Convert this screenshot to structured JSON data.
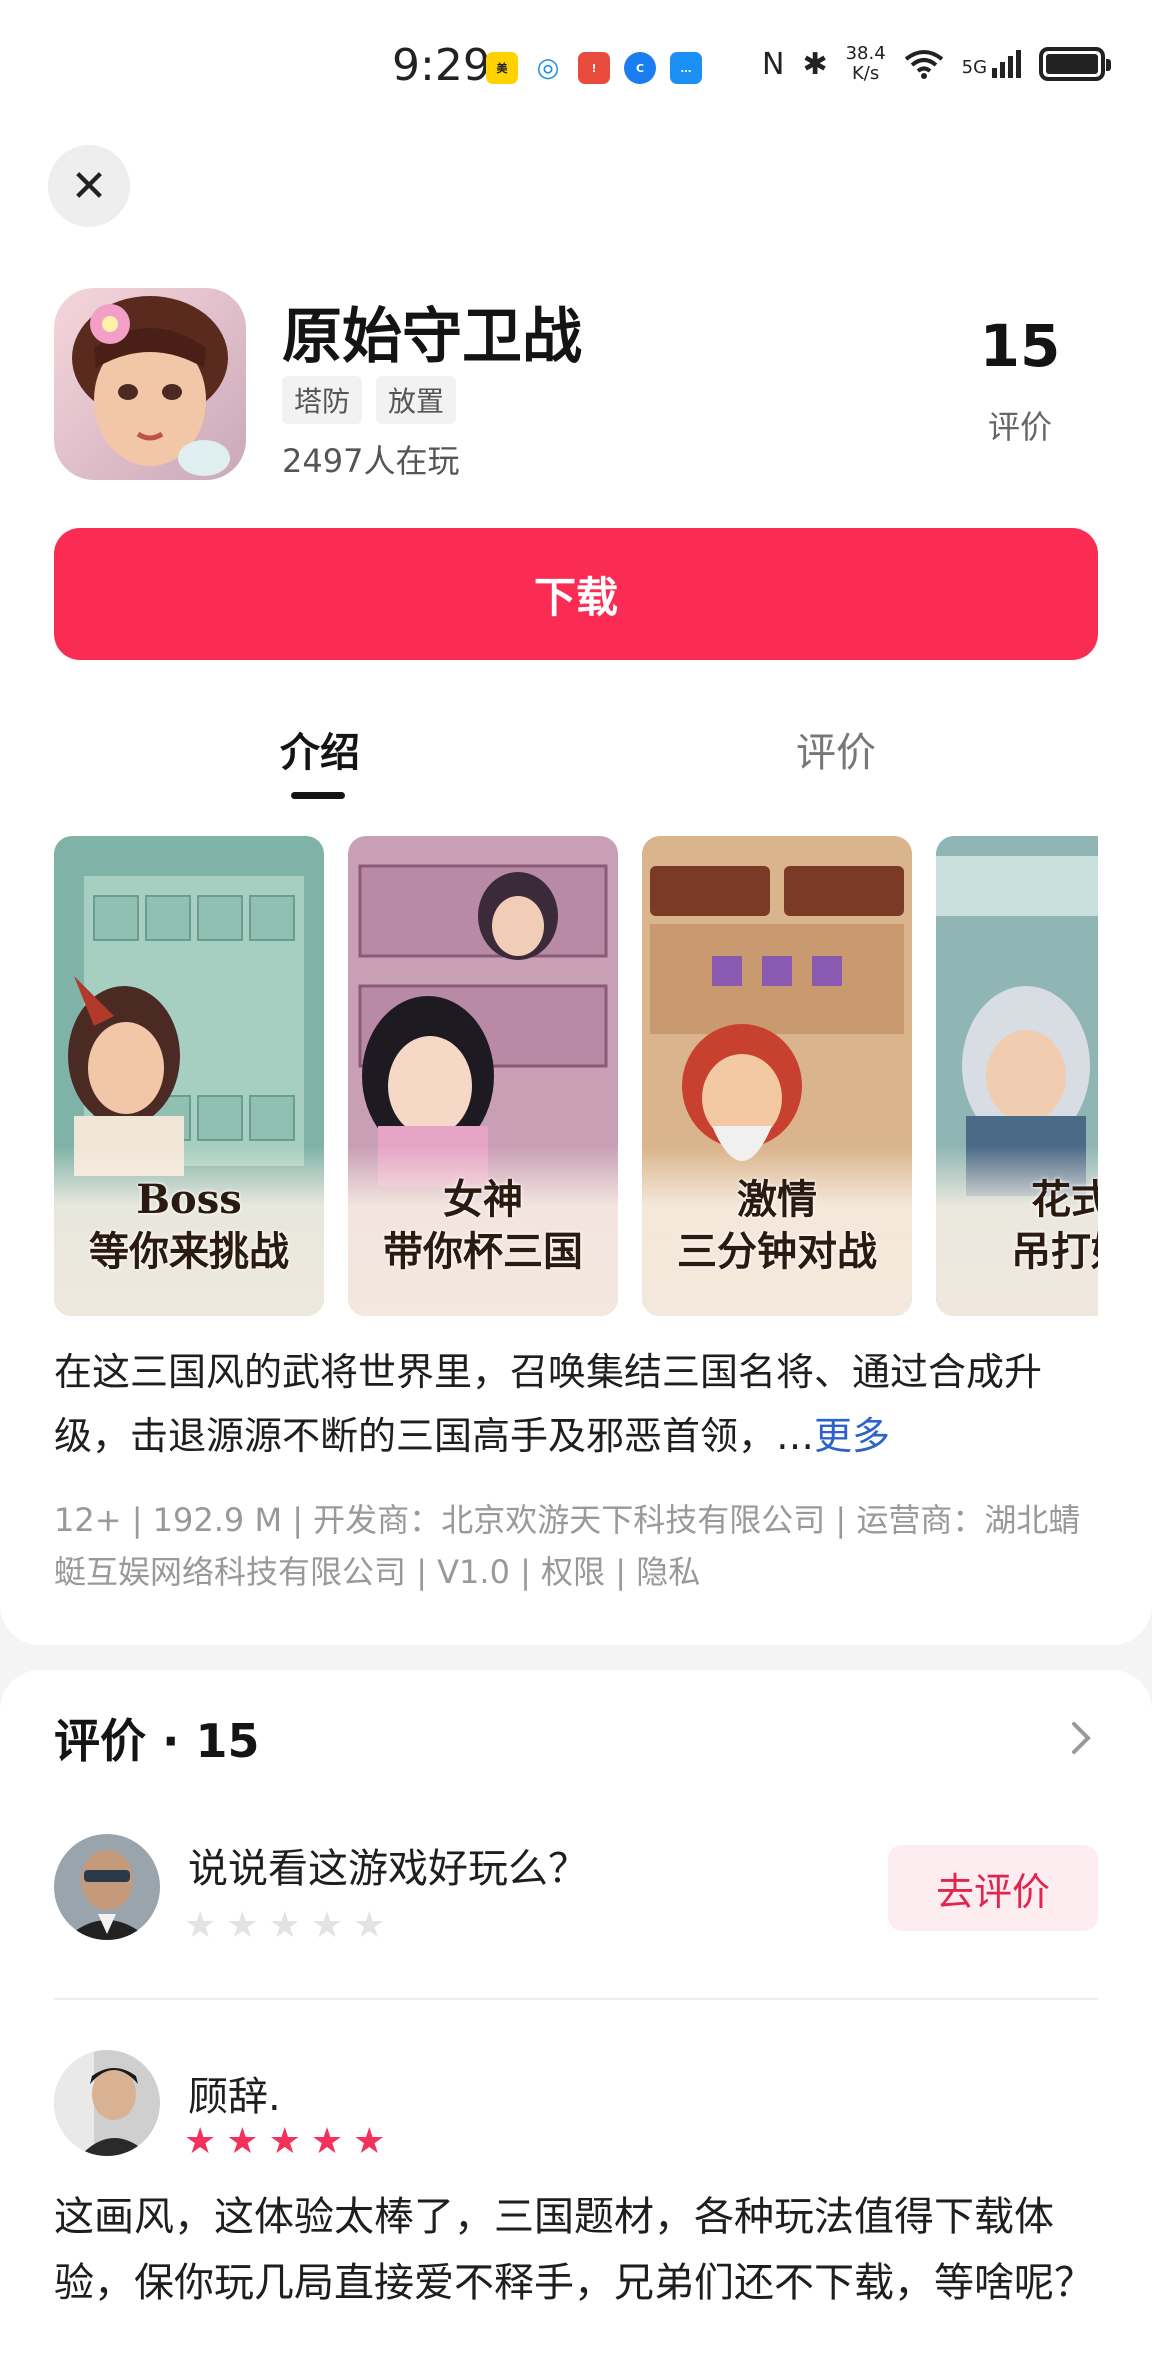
{
  "status_bar": {
    "time": "9:29",
    "net_speed_value": "38.4",
    "net_speed_unit": "K/s",
    "network": "5G",
    "notification_apps": [
      "meituan-icon",
      "chat-bubble-icon",
      "red-app-icon",
      "browser-icon",
      "message-icon"
    ]
  },
  "app": {
    "title": "原始守卫战",
    "tags": [
      "塔防",
      "放置"
    ],
    "players": "2497人在玩",
    "rating_count": "15",
    "rating_label": "评价",
    "download_label": "下载"
  },
  "tabs": [
    {
      "label": "介绍",
      "active": true
    },
    {
      "label": "评价",
      "active": false
    }
  ],
  "screenshots": [
    {
      "caption_line1": "Boss",
      "caption_line2": "等你来挑战"
    },
    {
      "caption_line1": "女神",
      "caption_line2": "带你杯三国"
    },
    {
      "caption_line1": "激情",
      "caption_line2": "三分钟对战"
    },
    {
      "caption_line1": "花式",
      "caption_line2": "吊打好"
    }
  ],
  "description": {
    "text": "在这三国风的武将世界里，召唤集结三国名将、通过合成升级，击退源源不断的三国高手及邪恶首领，…",
    "more_label": "更多"
  },
  "meta": {
    "age": "12+",
    "size": "192.9 M",
    "developer_label": "开发商：",
    "developer": "北京欢游天下科技有限公司",
    "operator_label": "运营商：",
    "operator": "湖北蜻蜓互娱网络科技有限公司",
    "version": "V1.0",
    "permissions": "权限",
    "privacy": "隐私",
    "separator": "|"
  },
  "reviews": {
    "heading": "评价 · 15",
    "prompt": "说说看这游戏好玩么？",
    "write_review_label": "去评价",
    "prompt_stars": 0,
    "items": [
      {
        "name": "顾辞.",
        "stars": 5,
        "text": "这画风，这体验太棒了，三国题材，各种玩法值得下载体验，保你玩几局直接爱不释手，兄弟们还不下载，等啥呢？"
      }
    ]
  },
  "colors": {
    "accent": "#fb2c54",
    "more_link": "#2c63c8",
    "star_filled": "#f2325a",
    "star_empty": "#e3e3e3"
  }
}
